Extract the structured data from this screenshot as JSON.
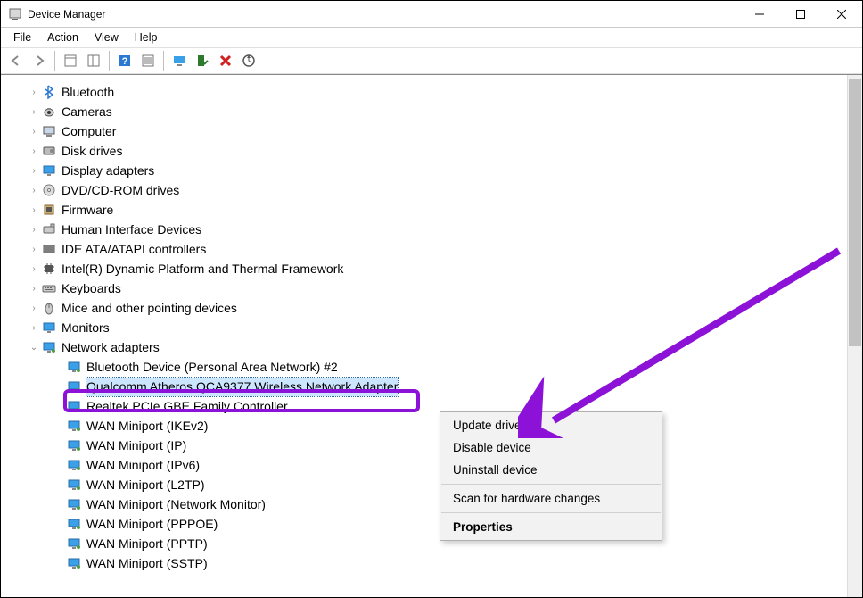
{
  "window": {
    "title": "Device Manager"
  },
  "menu": {
    "file": "File",
    "action": "Action",
    "view": "View",
    "help": "Help"
  },
  "tree_top": [
    {
      "name": "bluetooth",
      "label": "Bluetooth",
      "icon": "bt"
    },
    {
      "name": "cameras",
      "label": "Cameras",
      "icon": "cam"
    },
    {
      "name": "computer",
      "label": "Computer",
      "icon": "pc"
    },
    {
      "name": "disk-drives",
      "label": "Disk drives",
      "icon": "disk"
    },
    {
      "name": "display-adapters",
      "label": "Display adapters",
      "icon": "display"
    },
    {
      "name": "dvd-cdrom",
      "label": "DVD/CD-ROM drives",
      "icon": "dvd"
    },
    {
      "name": "firmware",
      "label": "Firmware",
      "icon": "fw"
    },
    {
      "name": "hid",
      "label": "Human Interface Devices",
      "icon": "hid"
    },
    {
      "name": "ide",
      "label": "IDE ATA/ATAPI controllers",
      "icon": "ide"
    },
    {
      "name": "intel-dptf",
      "label": "Intel(R) Dynamic Platform and Thermal Framework",
      "icon": "chip"
    },
    {
      "name": "keyboards",
      "label": "Keyboards",
      "icon": "kb"
    },
    {
      "name": "mice",
      "label": "Mice and other pointing devices",
      "icon": "mouse"
    },
    {
      "name": "monitors",
      "label": "Monitors",
      "icon": "monitor"
    }
  ],
  "network_adapters": {
    "label": "Network adapters",
    "items": [
      {
        "name": "bt-pan",
        "label": "Bluetooth Device (Personal Area Network) #2"
      },
      {
        "name": "qca9377",
        "label": "Qualcomm Atheros QCA9377 Wireless Network Adapter",
        "selected": true
      },
      {
        "name": "realtek-gbe",
        "label": "Realtek PCIe GBE Family Controller"
      },
      {
        "name": "wan-ikev2",
        "label": "WAN Miniport (IKEv2)"
      },
      {
        "name": "wan-ip",
        "label": "WAN Miniport (IP)"
      },
      {
        "name": "wan-ipv6",
        "label": "WAN Miniport (IPv6)"
      },
      {
        "name": "wan-l2tp",
        "label": "WAN Miniport (L2TP)"
      },
      {
        "name": "wan-netmon",
        "label": "WAN Miniport (Network Monitor)"
      },
      {
        "name": "wan-pppoe",
        "label": "WAN Miniport (PPPOE)"
      },
      {
        "name": "wan-pptp",
        "label": "WAN Miniport (PPTP)"
      },
      {
        "name": "wan-sstp",
        "label": "WAN Miniport (SSTP)"
      }
    ]
  },
  "context_menu": {
    "update_driver": "Update driver",
    "disable_device": "Disable device",
    "uninstall_device": "Uninstall device",
    "scan_hardware": "Scan for hardware changes",
    "properties": "Properties"
  },
  "annotation": {
    "highlight_color": "#8b12d6",
    "arrow_color": "#8b12d6"
  }
}
